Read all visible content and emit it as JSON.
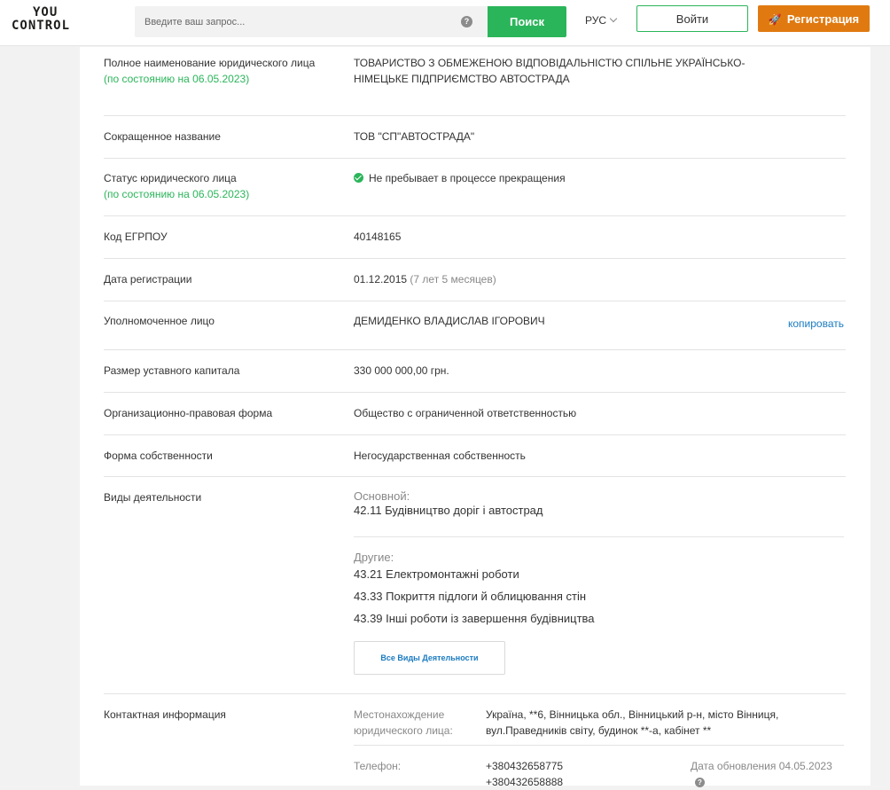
{
  "header": {
    "logo_line1": "YOU",
    "logo_line2": "CONTROL",
    "search_placeholder": "Введите ваш запрос...",
    "search_button": "Поиск",
    "language": "РУС",
    "login_button": "Войти",
    "register_button": "Регистрация"
  },
  "rows": {
    "full_name": {
      "label": "Полное наименование юридического лица",
      "date_note": "(по состоянию на 06.05.2023)",
      "value": "ТОВАРИСТВО З ОБМЕЖЕНОЮ ВІДПОВІДАЛЬНІСТЮ СПІЛЬНЕ УКРАЇНСЬКО-НІМЕЦЬКЕ ПІДПРИЄМСТВО АВТОСТРАДА"
    },
    "short_name": {
      "label": "Сокращенное название",
      "value": "ТОВ \"СП\"АВТОСТРАДА\""
    },
    "status": {
      "label": "Статус юридического лица",
      "date_note": "(по состоянию на 06.05.2023)",
      "value": "Не пребывает в процессе прекращения"
    },
    "edrpou": {
      "label": "Код ЕГРПОУ",
      "value": "40148165"
    },
    "reg_date": {
      "label": "Дата регистрации",
      "value": "01.12.2015",
      "age": "(7 лет 5 месяцев)"
    },
    "authorized": {
      "label": "Уполномоченное лицо",
      "value": "ДЕМИДЕНКО ВЛАДИСЛАВ ІГОРОВИЧ",
      "copy": "копировать"
    },
    "capital": {
      "label": "Размер уставного капитала",
      "value": "330 000 000,00 грн."
    },
    "legal_form": {
      "label": "Организационно-правовая форма",
      "value": "Общество с ограниченной ответственностью"
    },
    "ownership": {
      "label": "Форма собственности",
      "value": "Негосударственная собственность"
    },
    "activities": {
      "label": "Виды деятельности",
      "main_title": "Основной:",
      "main": "42.11 Будівництво доріг і автострад",
      "other_title": "Другие:",
      "other": [
        "43.21 Електромонтажні роботи",
        "43.33 Покриття підлоги й облицювання стін",
        "43.39 Інші роботи із завершення будівництва"
      ],
      "all_button": "Все Виды Деятельности"
    },
    "contacts": {
      "label": "Контактная информация",
      "address_label_1": "Местонахождение",
      "address_label_2": "юридического лица:",
      "address_1": "Україна, **6, Вінницька обл., Вінницький р-н, місто Вінниця,",
      "address_2": "вул.Праведників світу, будинок **-а, кабінет **",
      "phone_label": "Телефон:",
      "phones": [
        "+380432658775",
        "+380432658888"
      ],
      "updated": "Дата обновления 04.05.2023"
    }
  }
}
